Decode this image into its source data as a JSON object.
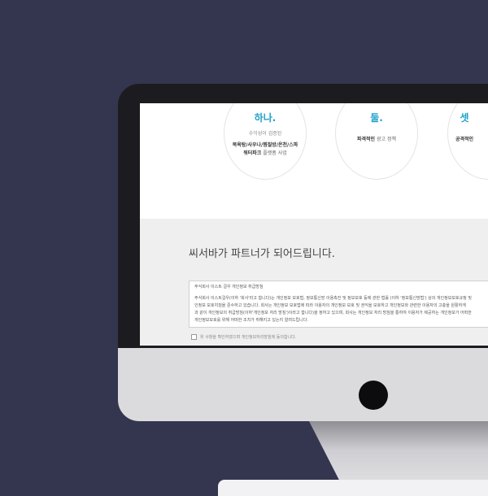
{
  "features": [
    {
      "title": "하나.",
      "sub": "수익성이 검증된",
      "bold1": "목욕탕/사우나/찜질방/온천/스파",
      "bold2": "워터파크",
      "rest": " 플랫폼 사업"
    },
    {
      "title": "둘.",
      "bold": "파격적인",
      "rest": " 광고 정책"
    },
    {
      "title": "셋",
      "bold": "공격적인"
    }
  ],
  "partner": {
    "heading": "씨서바가 파트너가 되어드립니다.",
    "policy_title": "주식회사 이스트 걸우 개인정보 취급방침",
    "policy_lines": [
      "주식회사 이스트걸우(이하 '회사'라고 합니다)는 개인정보 보호법, 정보통신망 이용촉진 및 정보보호 등에 관한 법률 (이하 '정보통신망법') 상의 개인정보보호규정 및",
      "인정보 보호지침을 준수하고 있습니다. 회사는 개인정보 보호법에 따라 이용자의 개인정보 보호 및 권익을 보호하고 개인정보와 관련한 이용자의 고충을 원활하게",
      "과 같이 개인정보의 취급방침(이하'개인정보 처리 방침')이라고 합니다)을 정하고 있으며, 회사는 개인정보 처리 방침을 통하여 이용자가 제공하는 개인정보가 어떠한",
      "개인정보보호를 위해 어떠한 조치가 취해지고 있는지 알려드립니다."
    ],
    "agree_label": "위 사항을 확인하였으며 개인정보처리방침에 동의합니다."
  }
}
